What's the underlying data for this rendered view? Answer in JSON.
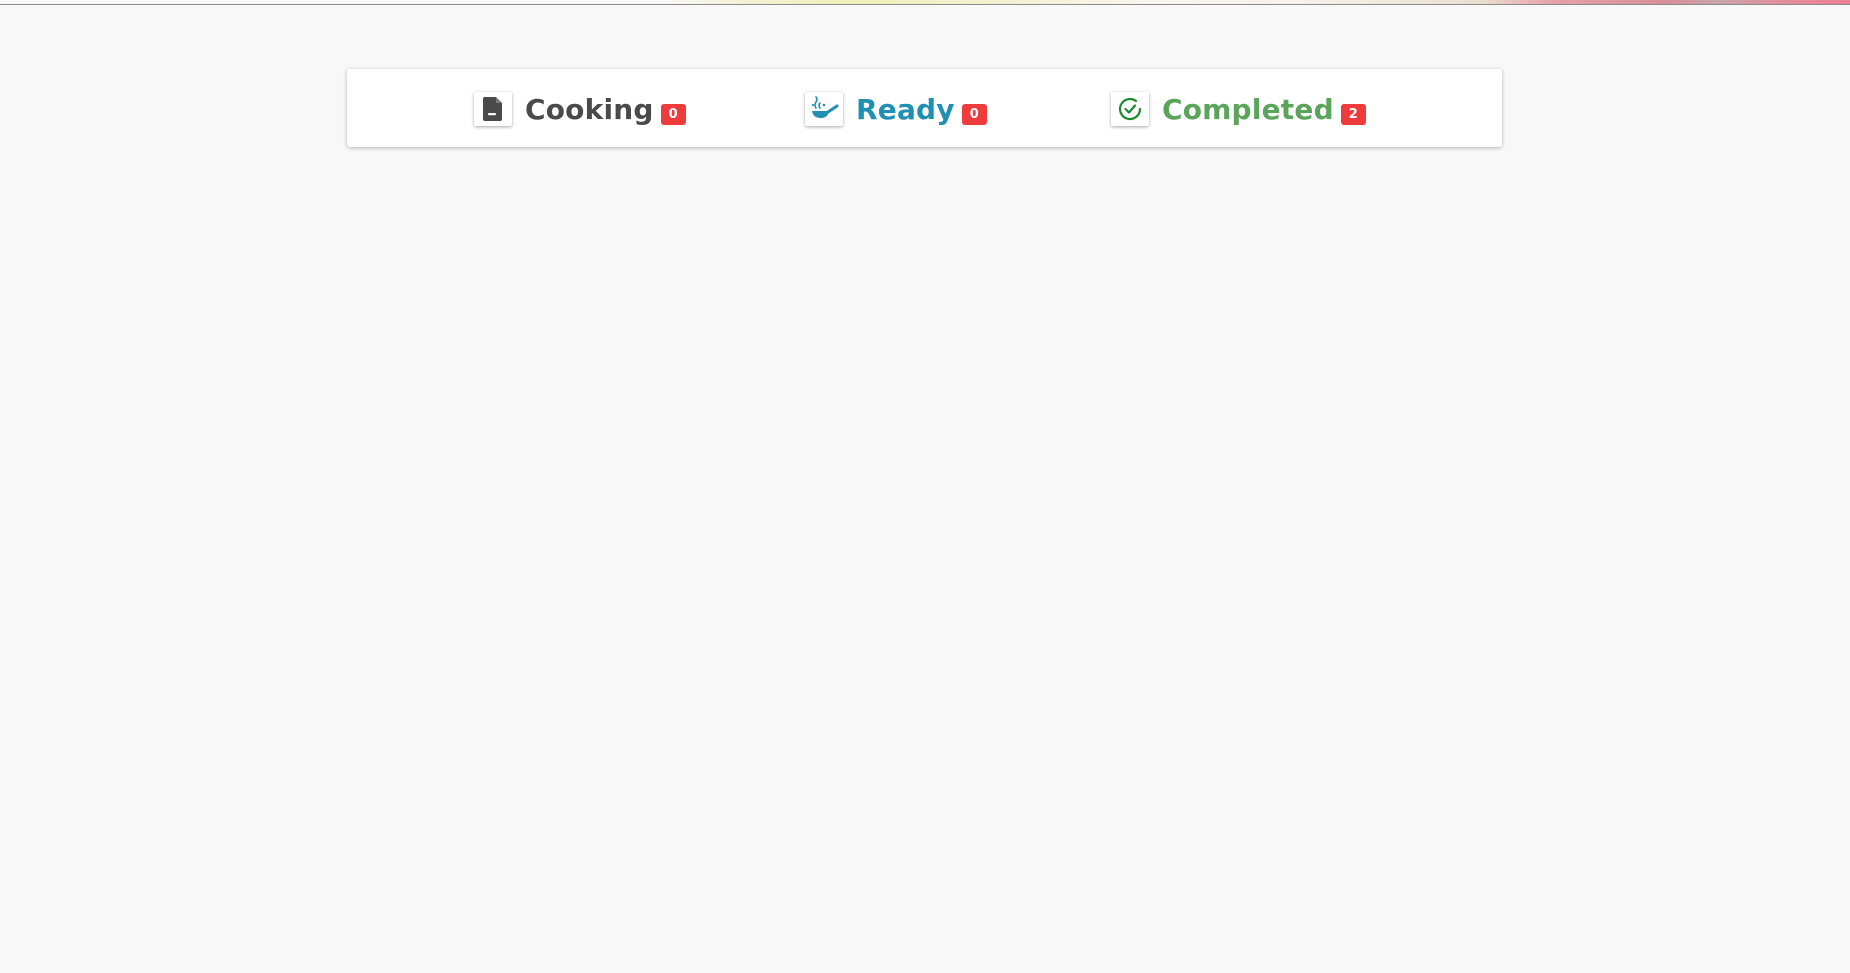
{
  "tabs": [
    {
      "id": "cooking",
      "label": "Cooking",
      "count": "0",
      "icon": "document-icon",
      "color": "#4a4a4a"
    },
    {
      "id": "ready",
      "label": "Ready",
      "count": "0",
      "icon": "cooking-pan-icon",
      "color": "#1f8fb3"
    },
    {
      "id": "completed",
      "label": "Completed",
      "count": "2",
      "icon": "check-circle-icon",
      "color": "#5aa55a"
    }
  ],
  "colors": {
    "badge": "#ee3b3b",
    "background": "#f8f8f8"
  }
}
